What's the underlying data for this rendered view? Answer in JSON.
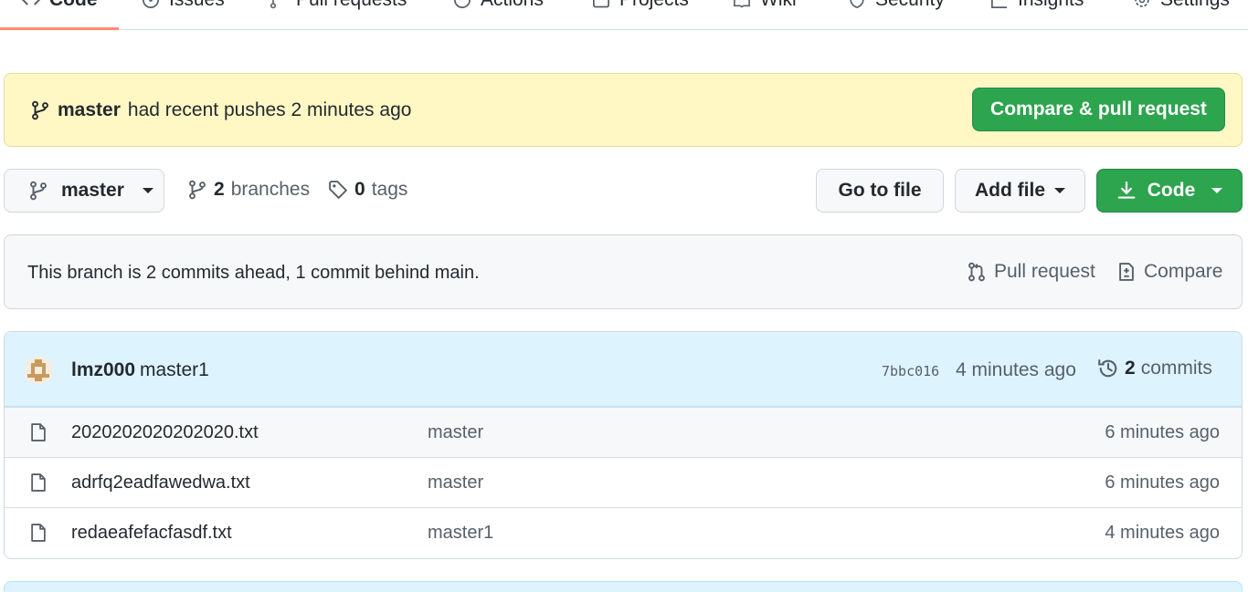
{
  "tabs": [
    {
      "label": "Code",
      "icon": "code-icon"
    },
    {
      "label": "Issues",
      "icon": "issue-icon"
    },
    {
      "label": "Pull requests",
      "icon": "pull-request-icon"
    },
    {
      "label": "Actions",
      "icon": "play-icon"
    },
    {
      "label": "Projects",
      "icon": "table-icon"
    },
    {
      "label": "Wiki",
      "icon": "book-icon"
    },
    {
      "label": "Security",
      "icon": "shield-icon"
    },
    {
      "label": "Insights",
      "icon": "graph-icon"
    },
    {
      "label": "Settings",
      "icon": "gear-icon"
    }
  ],
  "push_banner": {
    "branch": "master",
    "text": "had recent pushes 2 minutes ago",
    "button": "Compare & pull request"
  },
  "branch_bar": {
    "branch": "master",
    "branches_count": "2",
    "branches_label": "branches",
    "tags_count": "0",
    "tags_label": "tags",
    "go_to_file": "Go to file",
    "add_file": "Add file",
    "code": "Code"
  },
  "branch_info": {
    "text": "This branch is 2 commits ahead, 1 commit behind main.",
    "pull_request": "Pull request",
    "compare": "Compare"
  },
  "latest_commit": {
    "author": "lmz000",
    "message": "master1",
    "sha": "7bbc016",
    "age": "4 minutes ago",
    "commits_count": "2",
    "commits_label": "commits"
  },
  "files": [
    {
      "name": "2020202020202020.txt",
      "commit": "master",
      "age": "6 minutes ago"
    },
    {
      "name": "adrfq2eadfawedwa.txt",
      "commit": "master",
      "age": "6 minutes ago"
    },
    {
      "name": "redaeafefacfasdf.txt",
      "commit": "master1",
      "age": "4 minutes ago"
    }
  ],
  "colors": {
    "accent_green": "#2da44e",
    "banner_yellow": "#fff8c5",
    "commit_header_blue": "#ddf4ff",
    "tab_underline": "#fd8c73"
  }
}
